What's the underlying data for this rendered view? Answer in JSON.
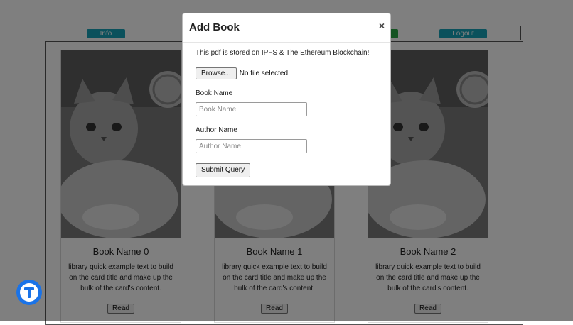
{
  "navbar": {
    "info_label": "Info",
    "add_label": "",
    "logout_label": "Logout"
  },
  "cards": [
    {
      "title": "Book Name 0",
      "text": "library quick example text to build on the card title and make up the bulk of the card's content.",
      "button": "Read",
      "image_icon": "kitten-photo"
    },
    {
      "title": "Book Name 1",
      "text": "library quick example text to build on the card title and make up the bulk of the card's content.",
      "button": "Read",
      "image_icon": "kitten-photo"
    },
    {
      "title": "Book Name 2",
      "text": "library quick example text to build on the card title and make up the bulk of the card's content.",
      "button": "Read",
      "image_icon": "kitten-photo"
    }
  ],
  "modal": {
    "title": "Add Book",
    "close": "×",
    "note": "This pdf is stored on IPFS & The Ethereum Blockchain!",
    "browse_label": "Browse...",
    "file_status": "No file selected.",
    "book_name_label": "Book Name",
    "book_name_placeholder": "Book Name",
    "book_name_value": "",
    "author_name_label": "Author Name",
    "author_name_placeholder": "Author Name",
    "author_name_value": "",
    "submit_label": "Submit Query"
  },
  "fab": {
    "icon": "t-logo-icon",
    "color": "#1a73e8"
  },
  "colors": {
    "info": "#17a2b8",
    "success": "#28a745",
    "overlay": "rgba(0,0,0,0.5)"
  }
}
